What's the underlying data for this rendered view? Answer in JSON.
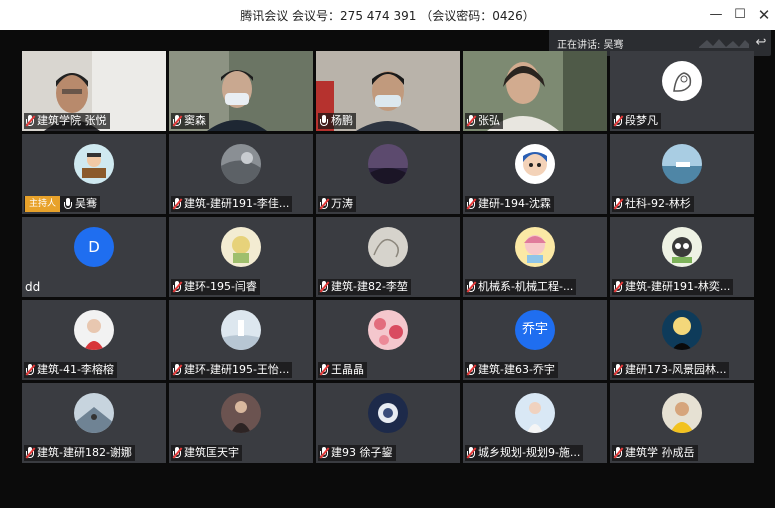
{
  "window": {
    "title": "腾讯会议 会议号：275 474 391 （会议密码：0426）"
  },
  "speaking": {
    "label": "正在讲话: 吴骞"
  },
  "host_badge": "主持人",
  "colors": {
    "tile": "#3a3c41",
    "host": "#e8a22a",
    "letter_avatar": "#1f6ef0",
    "muted": "#e53b3b"
  },
  "participants": [
    {
      "name": "建筑学院 张悦",
      "type": "video",
      "muted": true
    },
    {
      "name": "窦森",
      "type": "video",
      "muted": true
    },
    {
      "name": "杨鹏",
      "type": "video",
      "muted": false
    },
    {
      "name": "张弘",
      "type": "video",
      "muted": true
    },
    {
      "name": "段梦凡",
      "type": "avatar",
      "muted": true
    },
    {
      "name": "吴骞",
      "type": "avatar",
      "muted": false,
      "host": true
    },
    {
      "name": "建筑-建研191-李佳...",
      "type": "avatar",
      "muted": true
    },
    {
      "name": "万涛",
      "type": "avatar",
      "muted": true
    },
    {
      "name": "建研-194-沈霖",
      "type": "avatar",
      "muted": true
    },
    {
      "name": "社科-92-林杉",
      "type": "avatar",
      "muted": true
    },
    {
      "name": "dd",
      "type": "letter",
      "letter": "D",
      "muted": false
    },
    {
      "name": "建环-195-闫睿",
      "type": "avatar",
      "muted": true
    },
    {
      "name": "建筑-建82-李堃",
      "type": "avatar",
      "muted": true
    },
    {
      "name": "机械系-机械工程-...",
      "type": "avatar",
      "muted": true
    },
    {
      "name": "建筑-建研191-林奕...",
      "type": "avatar",
      "muted": true
    },
    {
      "name": "建筑-41-李榕榕",
      "type": "avatar",
      "muted": true
    },
    {
      "name": "建环-建研195-王怡...",
      "type": "avatar",
      "muted": true
    },
    {
      "name": "王晶晶",
      "type": "avatar",
      "muted": true
    },
    {
      "name": "建筑-建63-乔宇",
      "type": "letter",
      "letter": "乔宇",
      "muted": true
    },
    {
      "name": "建研173-风景园林...",
      "type": "avatar",
      "muted": true
    },
    {
      "name": "建筑-建研182-谢娜",
      "type": "avatar",
      "muted": true
    },
    {
      "name": "建筑匡天宇",
      "type": "avatar",
      "muted": true
    },
    {
      "name": "建93 徐子鋆",
      "type": "avatar",
      "muted": true
    },
    {
      "name": "城乡规划-规划9-施...",
      "type": "avatar",
      "muted": true
    },
    {
      "name": "建筑学  孙成岳",
      "type": "avatar",
      "muted": true
    }
  ]
}
